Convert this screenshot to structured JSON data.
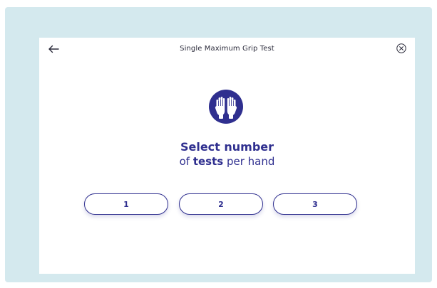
{
  "header": {
    "title": "Single Maximum Grip Test",
    "back_icon": "arrow-left-icon",
    "close_icon": "close-circle-icon"
  },
  "hero": {
    "icon": "raised-hands-icon",
    "color": "#2f2f8f"
  },
  "prompt": {
    "line1": "Select number",
    "line2_prefix": "of ",
    "line2_bold": "tests",
    "line2_suffix": " per hand"
  },
  "options": [
    {
      "label": "1"
    },
    {
      "label": "2"
    },
    {
      "label": "3"
    }
  ],
  "colors": {
    "accent": "#2f2f8f",
    "frame_background": "#d4e9ee",
    "screen_background": "#ffffff"
  }
}
